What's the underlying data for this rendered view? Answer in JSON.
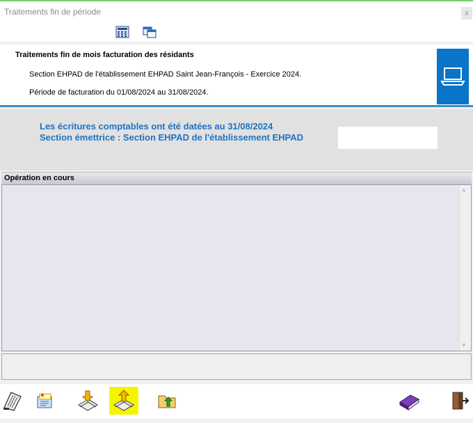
{
  "window": {
    "title": "Traitements fin de période",
    "close_label": "x"
  },
  "toolbar_top": {
    "icons": [
      "calculator-icon",
      "window-copy-icon"
    ]
  },
  "header_panel": {
    "title": "Traitements fin de mois facturation des résidants",
    "line1": "Section EHPAD de l'établissement EHPAD Saint Jean-François - Exercice 2024.",
    "line2": "Période de facturation du 01/08/2024 au 31/08/2024.",
    "icon": "computer-icon",
    "accent_color": "#0a74c8"
  },
  "messages": {
    "line1": "Les écritures comptables ont été datées au 31/08/2024",
    "line2": "Section émettrice : Section EHPAD de l'établissement EHPAD",
    "color": "#1b73c5"
  },
  "operation": {
    "header": "Opération en cours"
  },
  "bottom_toolbar": {
    "icons": [
      "document-print-icon",
      "folder-notes-icon",
      "download-docs-icon",
      "upload-docs-icon",
      "folder-up-icon",
      "book-icon",
      "exit-door-icon"
    ],
    "highlighted_icon": "upload-docs-icon",
    "highlight_color": "#f5f500"
  }
}
